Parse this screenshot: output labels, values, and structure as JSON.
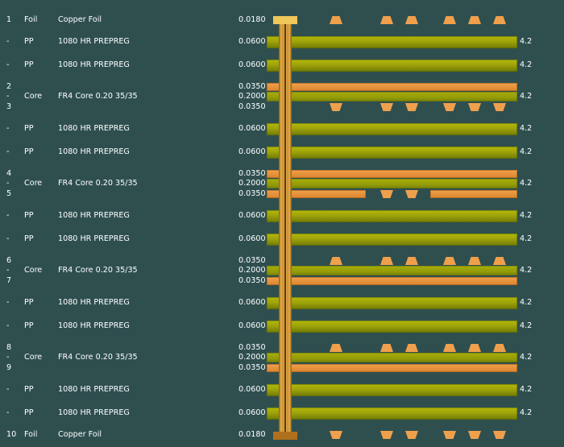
{
  "stackup": {
    "rows": [
      {
        "kind": "foil",
        "num": "1",
        "type": "Foil",
        "material": "Copper Foil",
        "thickness": "0.0180",
        "pads": "top"
      },
      {
        "kind": "pp",
        "num": "-",
        "type": "PP",
        "material": "1080 HR PREPREG",
        "thickness": "0.0600",
        "dk": "4.2"
      },
      {
        "kind": "pp",
        "num": "-",
        "type": "PP",
        "material": "1080 HR PREPREG",
        "thickness": "0.0600",
        "dk": "4.2"
      },
      {
        "kind": "core",
        "num_top": "2",
        "num": "-",
        "num_bot": "3",
        "type": "Core",
        "material": "FR4 Core 0.20 35/35",
        "th_top": "0.0350",
        "thickness": "0.2000",
        "th_bot": "0.0350",
        "dk": "4.2",
        "top_cu": "plane",
        "bot_cu": "pads"
      },
      {
        "kind": "pp",
        "num": "-",
        "type": "PP",
        "material": "1080 HR PREPREG",
        "thickness": "0.0600",
        "dk": "4.2"
      },
      {
        "kind": "pp",
        "num": "-",
        "type": "PP",
        "material": "1080 HR PREPREG",
        "thickness": "0.0600",
        "dk": "4.2"
      },
      {
        "kind": "core",
        "num_top": "4",
        "num": "-",
        "num_bot": "5",
        "type": "Core",
        "material": "FR4 Core 0.20 35/35",
        "th_top": "0.0350",
        "thickness": "0.2000",
        "th_bot": "0.0350",
        "dk": "4.2",
        "top_cu": "plane",
        "bot_cu": "split"
      },
      {
        "kind": "pp",
        "num": "-",
        "type": "PP",
        "material": "1080 HR PREPREG",
        "thickness": "0.0600",
        "dk": "4.2"
      },
      {
        "kind": "pp",
        "num": "-",
        "type": "PP",
        "material": "1080 HR PREPREG",
        "thickness": "0.0600",
        "dk": "4.2"
      },
      {
        "kind": "core",
        "num_top": "6",
        "num": "-",
        "num_bot": "7",
        "type": "Core",
        "material": "FR4 Core 0.20 35/35",
        "th_top": "0.0350",
        "thickness": "0.2000",
        "th_bot": "0.0350",
        "dk": "4.2",
        "top_cu": "pads",
        "bot_cu": "plane"
      },
      {
        "kind": "pp",
        "num": "-",
        "type": "PP",
        "material": "1080 HR PREPREG",
        "thickness": "0.0600",
        "dk": "4.2"
      },
      {
        "kind": "pp",
        "num": "-",
        "type": "PP",
        "material": "1080 HR PREPREG",
        "thickness": "0.0600",
        "dk": "4.2"
      },
      {
        "kind": "core",
        "num_top": "8",
        "num": "-",
        "num_bot": "9",
        "type": "Core",
        "material": "FR4 Core 0.20 35/35",
        "th_top": "0.0350",
        "thickness": "0.2000",
        "th_bot": "0.0350",
        "dk": "4.2",
        "top_cu": "pads",
        "bot_cu": "plane"
      },
      {
        "kind": "pp",
        "num": "-",
        "type": "PP",
        "material": "1080 HR PREPREG",
        "thickness": "0.0600",
        "dk": "4.2"
      },
      {
        "kind": "pp",
        "num": "-",
        "type": "PP",
        "material": "1080 HR PREPREG",
        "thickness": "0.0600",
        "dk": "4.2"
      },
      {
        "kind": "foil",
        "num": "10",
        "type": "Foil",
        "material": "Copper Foil",
        "thickness": "0.0180",
        "pads": "bottom"
      }
    ]
  },
  "colors": {
    "background": "#2f4f4f",
    "copper": "#f0a04c",
    "dielectric": "#9ea30a",
    "via": "#e6b34f"
  }
}
